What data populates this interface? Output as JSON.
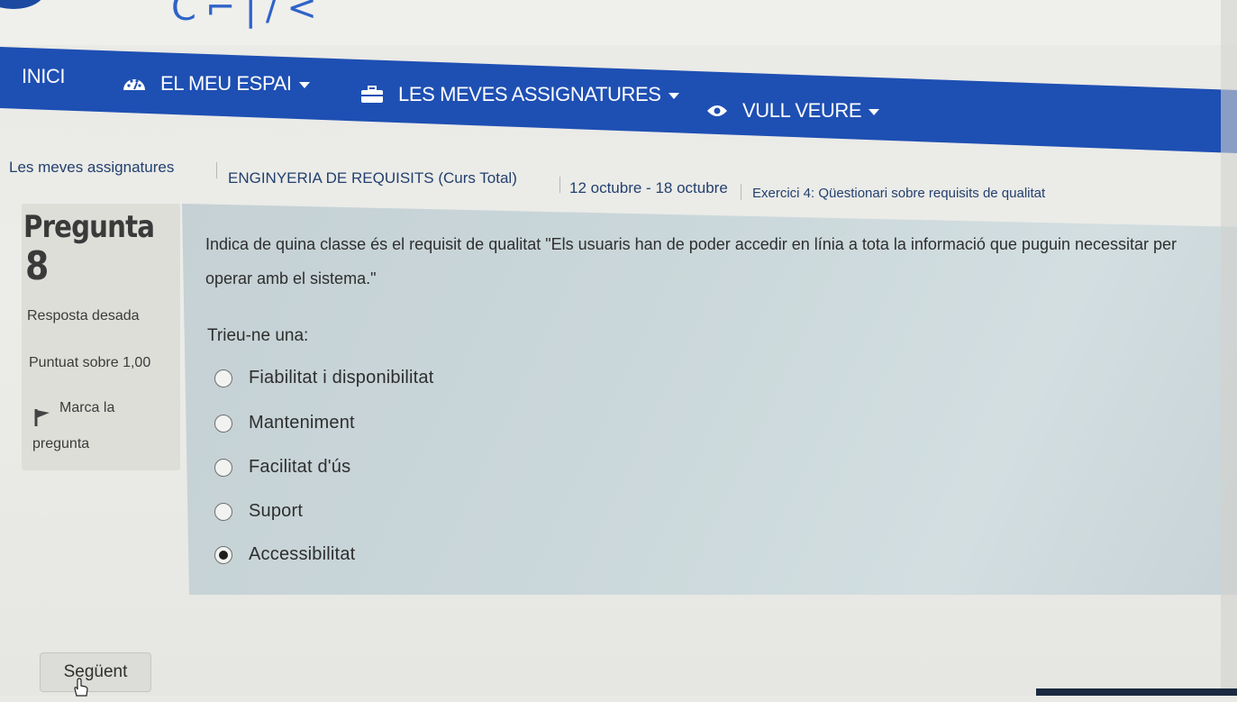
{
  "nav": {
    "home": "INICI",
    "my_space": "EL MEU ESPAI",
    "my_subjects": "LES MEVES ASSIGNATURES",
    "i_want_to_see": "VULL VEURE"
  },
  "breadcrumb": {
    "items": [
      "Les meves assignatures",
      "ENGINYERIA DE REQUISITS (Curs Total)",
      "12 octubre - 18 octubre",
      "Exercici 4: Qüestionari sobre requisits de qualitat"
    ]
  },
  "question_info": {
    "title": "Pregunta",
    "number": "8",
    "state": "Resposta desada",
    "grade": "Puntuat sobre 1,00",
    "flag_line1": "Marca la",
    "flag_line2": "pregunta"
  },
  "question": {
    "text": "Indica de quina classe és el requisit de qualitat \"Els usuaris han de poder accedir en línia a tota la informació que puguin necessitar per operar amb el sistema.\"",
    "prompt": "Trieu-ne una:",
    "options": [
      {
        "label": "Fiabilitat i disponibilitat",
        "selected": false
      },
      {
        "label": "Manteniment",
        "selected": false
      },
      {
        "label": "Facilitat d'ús",
        "selected": false
      },
      {
        "label": "Suport",
        "selected": false
      },
      {
        "label": "Accessibilitat",
        "selected": true
      }
    ]
  },
  "footer": {
    "next_label": "Següent"
  },
  "colors": {
    "navbar": "#1e4fb3",
    "content_box": "#cad7da",
    "info_box": "#deded9"
  },
  "icons": {
    "my_space": "dashboard-gauge-icon",
    "my_subjects": "briefcase-icon",
    "i_want_to_see": "eye-icon",
    "flag": "flag-icon"
  }
}
